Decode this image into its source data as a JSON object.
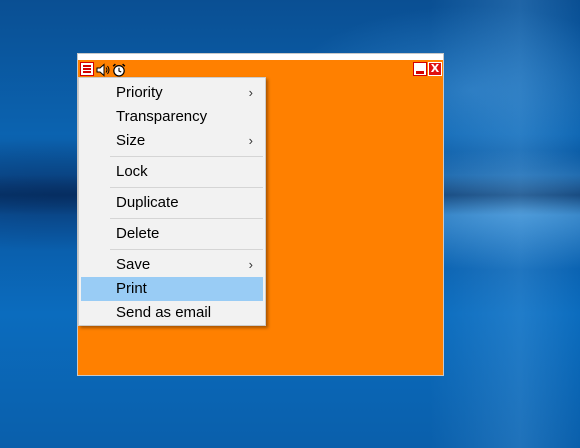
{
  "desktop": {
    "wallpaper": "windows-10-blue"
  },
  "note_window": {
    "background_color": "#ff8000",
    "toolbar": {
      "menu_icon": "hamburger-menu-icon",
      "sound_icon": "speaker-icon",
      "alarm_icon": "alarm-clock-icon",
      "minimize_icon": "minimize-icon",
      "close_icon": "close-icon",
      "close_glyph": "X"
    }
  },
  "context_menu": {
    "highlight_color": "#99ccf5",
    "items": [
      {
        "label": "Priority",
        "submenu_arrow": "›"
      },
      {
        "label": "Transparency"
      },
      {
        "label": "Size",
        "submenu_arrow": "›"
      },
      {
        "label": "Lock"
      },
      {
        "label": "Duplicate"
      },
      {
        "label": "Delete"
      },
      {
        "label": "Save",
        "submenu_arrow": "›"
      },
      {
        "label": "Print",
        "highlighted": true
      },
      {
        "label": "Send as email"
      }
    ]
  }
}
